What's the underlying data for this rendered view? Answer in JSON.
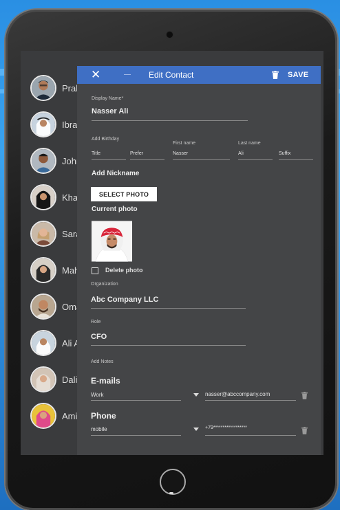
{
  "contacts": [
    {
      "name": "Prak"
    },
    {
      "name": "Ibral"
    },
    {
      "name": "John"
    },
    {
      "name": "Khad"
    },
    {
      "name": "Sara"
    },
    {
      "name": "Mah"
    },
    {
      "name": "Oma"
    },
    {
      "name": "Ali A"
    },
    {
      "name": "Dalia"
    },
    {
      "name": "Ami"
    }
  ],
  "dialog": {
    "close_icon": "close-icon",
    "title": "Edit Contact",
    "save_label": "SAVE",
    "accent_color": "#3f6fc4",
    "display_name": {
      "label": "Display Name*",
      "value": "Nasser Ali"
    },
    "birthday": {
      "label": "Add Birthday"
    },
    "title_field": {
      "value": "Title"
    },
    "prefix_field": {
      "value": "Prefer"
    },
    "first_name": {
      "label": "First name",
      "value": "Nasser"
    },
    "last_name": {
      "label": "Last name",
      "value": "Ali"
    },
    "suffix_field": {
      "value": "Suffix"
    },
    "nickname": {
      "label": "Add Nickname"
    },
    "select_photo_label": "SELECT PHOTO",
    "current_photo_label": "Current photo",
    "delete_photo_label": "Delete photo",
    "organization": {
      "label": "Organization",
      "value": "Abc Company LLC"
    },
    "role": {
      "label": "Role",
      "value": "CFO"
    },
    "notes": {
      "label": "Add Notes"
    },
    "emails": {
      "label": "E-mails",
      "type": "Work",
      "value": "nasser@abccompany.com"
    },
    "phone": {
      "label": "Phone",
      "type": "mobile",
      "value": "+79******************"
    }
  }
}
